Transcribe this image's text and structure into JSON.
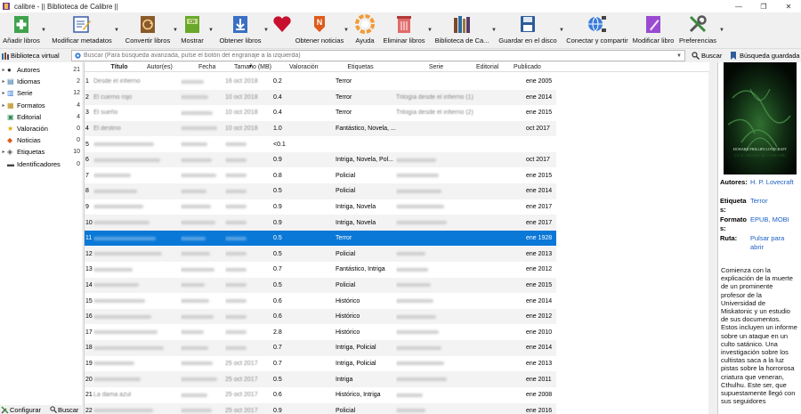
{
  "window": {
    "title": "calibre - || Biblioteca de Calibre ||",
    "controls": [
      "—",
      "❐",
      "✕"
    ]
  },
  "toolbar": [
    {
      "label": "Añadir libros",
      "icon": "add-books-icon",
      "arrow": true
    },
    {
      "label": "Modificar metadatos",
      "icon": "edit-metadata-icon",
      "arrow": true
    },
    {
      "label": "Convertir libros",
      "icon": "convert-books-icon",
      "arrow": true
    },
    {
      "label": "Mostrar",
      "icon": "view-book-icon",
      "arrow": true
    },
    {
      "label": "Obtener libros",
      "icon": "get-books-icon",
      "arrow": true
    },
    {
      "label": "",
      "icon": "heart-icon",
      "arrow": false
    },
    {
      "label": "Obtener noticias",
      "icon": "fetch-news-icon",
      "arrow": true
    },
    {
      "label": "Ayuda",
      "icon": "help-icon",
      "arrow": false
    },
    {
      "label": "Eliminar libros",
      "icon": "remove-books-icon",
      "arrow": true
    },
    {
      "label": "Biblioteca de Ca...",
      "icon": "library-icon",
      "arrow": true
    },
    {
      "label": "Guardar en el disco",
      "icon": "save-disk-icon",
      "arrow": true
    },
    {
      "label": "Conectar y compartir",
      "icon": "connect-share-icon",
      "arrow": false
    },
    {
      "label": "Modificar libro",
      "icon": "edit-book-icon",
      "arrow": false
    },
    {
      "label": "Preferencias",
      "icon": "preferences-icon",
      "arrow": true
    }
  ],
  "searchbar": {
    "virtual_library": "Biblioteca virtual",
    "placeholder": "Buscar (Para búsqueda avanzada, pulse el botón del engranaje a la izquierda)",
    "search_button": "Buscar",
    "saved_search_button": "Búsqueda guardada"
  },
  "tag_browser": {
    "items": [
      {
        "label": "Autores",
        "count": "21",
        "icon": "authors-icon",
        "expandable": true
      },
      {
        "label": "Idiomas",
        "count": "2",
        "icon": "languages-icon",
        "expandable": true
      },
      {
        "label": "Serie",
        "count": "12",
        "icon": "series-icon",
        "expandable": true
      },
      {
        "label": "Formatos",
        "count": "4",
        "icon": "formats-icon",
        "expandable": true
      },
      {
        "label": "Editorial",
        "count": "4",
        "icon": "publisher-icon",
        "expandable": false
      },
      {
        "label": "Valoración",
        "count": "0",
        "icon": "rating-icon",
        "expandable": false
      },
      {
        "label": "Noticias",
        "count": "0",
        "icon": "news-icon",
        "expandable": false
      },
      {
        "label": "Etiquetas",
        "count": "10",
        "icon": "tags-icon",
        "expandable": true
      },
      {
        "label": "Identificadores",
        "count": "0",
        "icon": "identifiers-icon",
        "expandable": false
      }
    ],
    "configure": "Configurar",
    "find": "Buscar"
  },
  "book_list": {
    "columns": [
      "Título",
      "Autor(es)",
      "Fecha",
      "Tamaño (MB)",
      "Valoración",
      "Etiquetas",
      "Serie",
      "Editorial",
      "Publicado"
    ],
    "rows": [
      {
        "num": "1",
        "title": "Desde el infierno",
        "fecha": "16 oct 2018",
        "size": "0.2",
        "tags": "Terror",
        "series": "",
        "published": "ene 2005",
        "selected": false
      },
      {
        "num": "2",
        "title": "El cuerno rojo",
        "fecha": "10 oct 2018",
        "size": "0.4",
        "tags": "Terror",
        "series": "Trilogía desde el infierno (1)",
        "published": "ene 2014",
        "selected": false
      },
      {
        "num": "3",
        "title": "El sueño",
        "fecha": "10 oct 2018",
        "size": "0.4",
        "tags": "Terror",
        "series": "Trilogía desde el infierno (2)",
        "published": "ene 2015",
        "selected": false
      },
      {
        "num": "4",
        "title": "El destino",
        "fecha": "10 oct 2018",
        "size": "1.0",
        "tags": "Fantástico, Novela, ...",
        "series": "",
        "published": "oct 2017",
        "selected": false
      },
      {
        "num": "5",
        "title": "",
        "fecha": "",
        "size": "<0.1",
        "tags": "",
        "series": "",
        "published": "",
        "selected": false
      },
      {
        "num": "6",
        "title": "",
        "fecha": "",
        "size": "0.9",
        "tags": "Intriga, Novela, Pol...",
        "series": "",
        "published": "oct 2017",
        "selected": false
      },
      {
        "num": "7",
        "title": "",
        "fecha": "",
        "size": "0.8",
        "tags": "Policial",
        "series": "",
        "published": "ene 2015",
        "selected": false
      },
      {
        "num": "8",
        "title": "",
        "fecha": "",
        "size": "0.5",
        "tags": "Policial",
        "series": "",
        "published": "ene 2014",
        "selected": false
      },
      {
        "num": "9",
        "title": "",
        "fecha": "",
        "size": "0.9",
        "tags": "Intriga, Novela",
        "series": "",
        "published": "ene 2017",
        "selected": false
      },
      {
        "num": "10",
        "title": "",
        "fecha": "",
        "size": "0.9",
        "tags": "Intriga, Novela",
        "series": "",
        "published": "ene 2017",
        "selected": false
      },
      {
        "num": "11",
        "title": "",
        "fecha": "",
        "size": "0.5",
        "tags": "Terror",
        "series": "",
        "published": "ene 1928",
        "selected": true
      },
      {
        "num": "12",
        "title": "",
        "fecha": "",
        "size": "0.5",
        "tags": "Policial",
        "series": "",
        "published": "ene 2013",
        "selected": false
      },
      {
        "num": "13",
        "title": "",
        "fecha": "",
        "size": "0.7",
        "tags": "Fantástico, Intriga",
        "series": "",
        "published": "ene 2012",
        "selected": false
      },
      {
        "num": "14",
        "title": "",
        "fecha": "",
        "size": "0.5",
        "tags": "Policial",
        "series": "",
        "published": "ene 2015",
        "selected": false
      },
      {
        "num": "15",
        "title": "",
        "fecha": "",
        "size": "0.6",
        "tags": "Histórico",
        "series": "",
        "published": "ene 2014",
        "selected": false
      },
      {
        "num": "16",
        "title": "",
        "fecha": "",
        "size": "0.6",
        "tags": "Histórico",
        "series": "",
        "published": "ene 2012",
        "selected": false
      },
      {
        "num": "17",
        "title": "",
        "fecha": "",
        "size": "2.8",
        "tags": "Histórico",
        "series": "",
        "published": "ene 2010",
        "selected": false
      },
      {
        "num": "18",
        "title": "",
        "fecha": "",
        "size": "0.7",
        "tags": "Intriga, Policial",
        "series": "",
        "published": "ene 2014",
        "selected": false
      },
      {
        "num": "19",
        "title": "",
        "fecha": "25 oct 2017",
        "size": "0.7",
        "tags": "Intriga, Policial",
        "series": "",
        "published": "ene 2013",
        "selected": false
      },
      {
        "num": "20",
        "title": "",
        "fecha": "25 oct 2017",
        "size": "0.5",
        "tags": "Intriga",
        "series": "",
        "published": "ene 2011",
        "selected": false
      },
      {
        "num": "21",
        "title": "La dama azul",
        "fecha": "25 oct 2017",
        "size": "0.6",
        "tags": "Histórico, Intriga",
        "series": "",
        "published": "ene 2008",
        "selected": false
      },
      {
        "num": "22",
        "title": "",
        "fecha": "25 oct 2017",
        "size": "0.9",
        "tags": "Policial",
        "series": "",
        "published": "ene 2016",
        "selected": false
      }
    ]
  },
  "details": {
    "cover_author": "HOWARD PHILLIPS LOVECRAFT",
    "cover_title": "LA LLAMADA DE CTHULHU",
    "fields": [
      {
        "key": "Autores:",
        "value": "H. P. Lovecraft"
      },
      {
        "key": "Etiquetas:",
        "value": "Terror"
      },
      {
        "key": "Formatos:",
        "value": "EPUB, MOBI"
      },
      {
        "key": "Ruta:",
        "value": "Pulsar para abrir"
      }
    ],
    "comments": "Comienza con la explicación de la muerte de un prominente profesor de la Universidad de Miskatonic y un estudio de sus documentos. Estos incluyen un informe sobre un ataque en un culto satánico. Una investigación sobre los cultistas saca a la luz pistas sobre la horrorosa criatura que veneran, Cthulhu. Este ser, que supuestamente llegó con sus seguidores"
  },
  "colors": {
    "selection": "#0a78d7",
    "link": "#1a5fc4"
  }
}
